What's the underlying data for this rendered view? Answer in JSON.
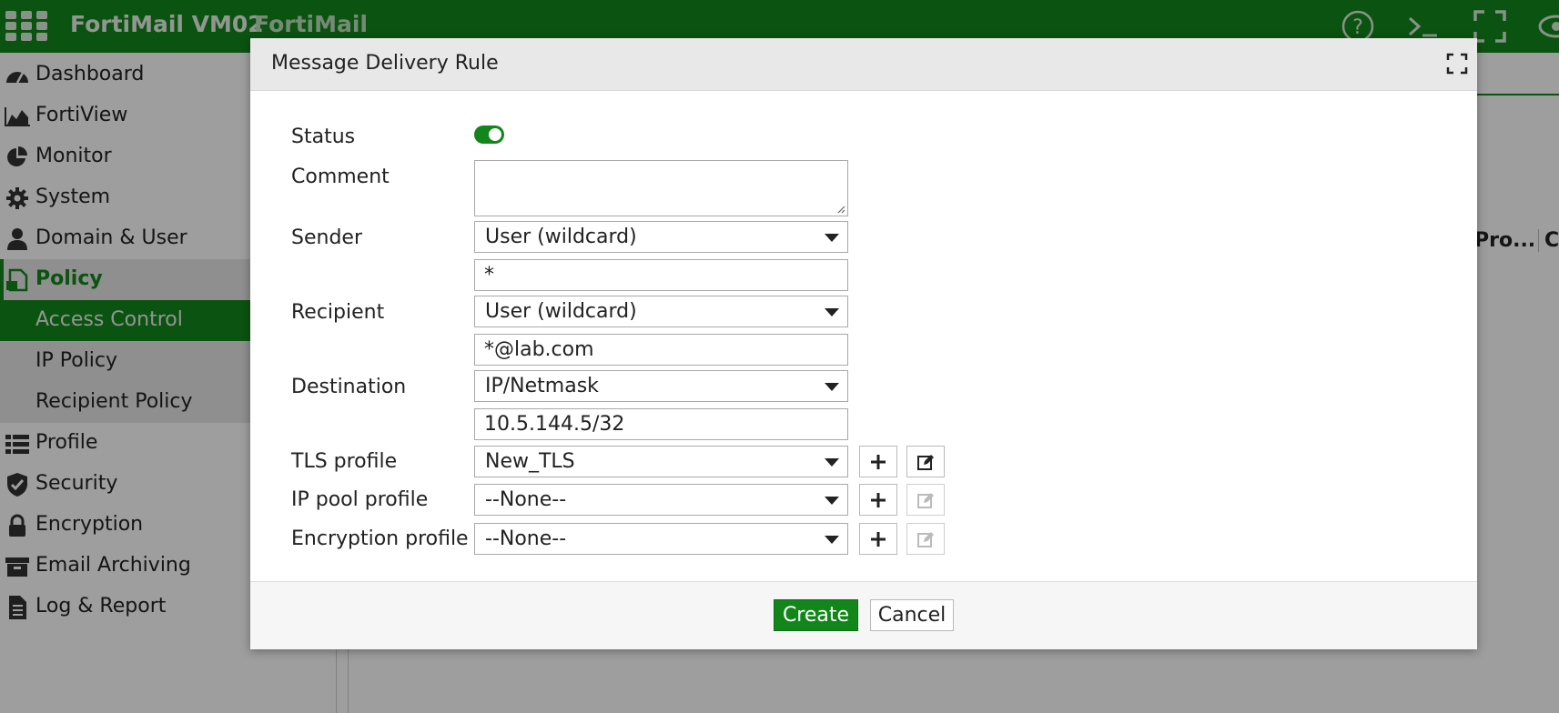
{
  "topbar": {
    "product": "FortiMail VM02",
    "host": "FortiMail",
    "icons": [
      "apps-grid-icon",
      "help-icon",
      "cli-console-icon",
      "fullscreen-icon",
      "eye-icon"
    ]
  },
  "sidebar": {
    "items": [
      {
        "label": "Dashboard",
        "icon": "dashboard-icon"
      },
      {
        "label": "FortiView",
        "icon": "area-chart-icon"
      },
      {
        "label": "Monitor",
        "icon": "pie-chart-icon"
      },
      {
        "label": "System",
        "icon": "gear-icon"
      },
      {
        "label": "Domain & User",
        "icon": "user-icon"
      },
      {
        "label": "Policy",
        "icon": "policy-document-icon"
      },
      {
        "label": "Access Control",
        "icon": ""
      },
      {
        "label": "IP Policy",
        "icon": ""
      },
      {
        "label": "Recipient Policy",
        "icon": ""
      },
      {
        "label": "Profile",
        "icon": "list-icon"
      },
      {
        "label": "Security",
        "icon": "shield-icon"
      },
      {
        "label": "Encryption",
        "icon": "lock-icon"
      },
      {
        "label": "Email Archiving",
        "icon": "archive-box-icon"
      },
      {
        "label": "Log & Report",
        "icon": "report-document-icon"
      }
    ]
  },
  "background": {
    "col_head_1": "Pro...",
    "col_head_2": "C"
  },
  "modal": {
    "title": "Message Delivery Rule",
    "status_label": "Status",
    "status_on": true,
    "comment_label": "Comment",
    "sender_label": "Sender",
    "sender_type": "User (wildcard)",
    "sender_value": "*",
    "recipient_label": "Recipient",
    "recipient_type": "User (wildcard)",
    "recipient_value": "*@lab.com",
    "destination_label": "Destination",
    "destination_type": "IP/Netmask",
    "destination_value": "10.5.144.5/32",
    "tls_label": "TLS profile",
    "tls_value": "New_TLS",
    "ippool_label": "IP pool profile",
    "ippool_value": "--None--",
    "encryption_label": "Encryption profile",
    "encryption_value": "--None--",
    "create_label": "Create",
    "cancel_label": "Cancel"
  },
  "colors": {
    "brand_green": "#12861a",
    "overlay": "rgba(0,0,0,0.38)"
  }
}
